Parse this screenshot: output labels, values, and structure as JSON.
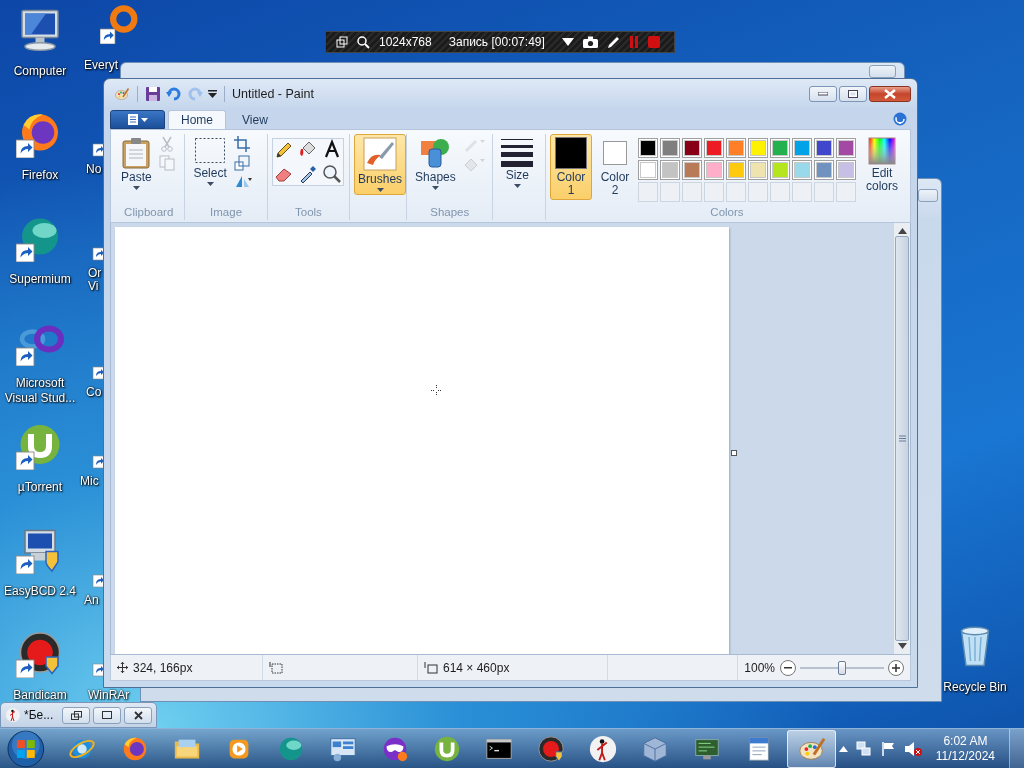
{
  "recorder_bar": {
    "resolution": "1024x768",
    "status": "Запись [00:07:49]"
  },
  "desktop_icons": [
    {
      "label": "Computer",
      "kind": "computer"
    },
    {
      "label": "Firefox",
      "kind": "firefox"
    },
    {
      "label": "Supermium",
      "kind": "supermium"
    },
    {
      "label": "Microsoft Visual Stud...",
      "kind": "vs"
    },
    {
      "label": "µTorrent",
      "kind": "utorrent"
    },
    {
      "label": "EasyBCD 2.4",
      "kind": "easybcd"
    },
    {
      "label": "Bandicam",
      "kind": "bandicam"
    }
  ],
  "partial_desktop_icons": [
    {
      "label": "Everyt",
      "kind": "everything"
    },
    {
      "label": "No",
      "kind": "shortcut"
    },
    {
      "label": "Or Vi",
      "kind": "shortcut"
    },
    {
      "label": "Co",
      "kind": "shortcut"
    },
    {
      "label": "Mic",
      "kind": "shortcut"
    },
    {
      "label": "An",
      "kind": "shortcut"
    },
    {
      "label": "WinRAr",
      "kind": "shortcut"
    }
  ],
  "recycle_bin": {
    "label": "Recycle Bin"
  },
  "paint": {
    "title": "Untitled - Paint",
    "redo": {
      "disabled": true
    },
    "tabs": [
      {
        "label": "Home",
        "selected": true
      },
      {
        "label": "View",
        "selected": false
      }
    ],
    "clipboard": {
      "label": "Clipboard",
      "paste": "Paste",
      "cut": {
        "disabled": true
      },
      "copy": {
        "disabled": true
      }
    },
    "image": {
      "label": "Image",
      "select": "Select"
    },
    "tools": {
      "label": "Tools"
    },
    "brushes": {
      "label": "Brushes",
      "selected": true
    },
    "shapes": {
      "label": "Shapes",
      "group_label": "Shapes",
      "outline": {
        "disabled": true
      },
      "fill": {
        "disabled": true
      }
    },
    "size": {
      "label": "Size"
    },
    "colors": {
      "group_label": "Colors",
      "color1": {
        "label": "Color 1",
        "color": "#000000",
        "selected": true
      },
      "color2": {
        "label": "Color 2",
        "color": "#ffffff",
        "selected": false
      },
      "edit": "Edit colors",
      "palette": [
        {
          "color": "#000000"
        },
        {
          "color": "#7f7f7f"
        },
        {
          "color": "#880015"
        },
        {
          "color": "#ed1c24"
        },
        {
          "color": "#ff7f27"
        },
        {
          "color": "#fff200"
        },
        {
          "color": "#22b14c"
        },
        {
          "color": "#00a2e8"
        },
        {
          "color": "#3f48cc"
        },
        {
          "color": "#a349a4"
        },
        {
          "color": "#ffffff"
        },
        {
          "color": "#c3c3c3"
        },
        {
          "color": "#b97a57"
        },
        {
          "color": "#ffaec9"
        },
        {
          "color": "#ffc90e"
        },
        {
          "color": "#efe4b0"
        },
        {
          "color": "#b5e61d"
        },
        {
          "color": "#99d9ea"
        },
        {
          "color": "#7092be"
        },
        {
          "color": "#c8bfe7"
        }
      ]
    },
    "status": {
      "position": "324, 166px",
      "canvas_size": "614 × 460px",
      "zoom": "100%",
      "zoom_slider": {
        "level": 0.5
      }
    }
  },
  "minimized_window": {
    "title": "*Бе..."
  },
  "taskbar": {
    "apps": [
      {
        "kind": "ie",
        "selected": false
      },
      {
        "kind": "firefox",
        "selected": false
      },
      {
        "kind": "explorer",
        "selected": false
      },
      {
        "kind": "media",
        "selected": false
      },
      {
        "kind": "supermium",
        "selected": false
      },
      {
        "kind": "control",
        "selected": false
      },
      {
        "kind": "mask",
        "selected": false
      },
      {
        "kind": "utorrent",
        "selected": false
      },
      {
        "kind": "cmd",
        "selected": false
      },
      {
        "kind": "bandicam",
        "selected": false
      },
      {
        "kind": "stickman",
        "selected": false
      },
      {
        "kind": "virtualbox",
        "selected": false
      },
      {
        "kind": "monitor",
        "selected": false
      },
      {
        "kind": "wordpad",
        "selected": false
      },
      {
        "kind": "paint",
        "selected": true
      }
    ],
    "clock": {
      "time": "6:02 AM",
      "date": "11/12/2024"
    }
  }
}
